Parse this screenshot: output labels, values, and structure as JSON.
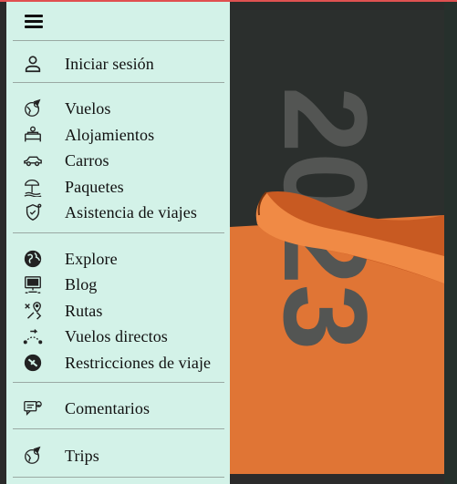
{
  "menu": {
    "account": [
      {
        "id": "login",
        "label": "Iniciar sesión",
        "icon": "user-icon"
      }
    ],
    "travel": [
      {
        "id": "flights",
        "label": "Vuelos",
        "icon": "globe-plane-icon"
      },
      {
        "id": "lodging",
        "label": "Alojamientos",
        "icon": "bed-icon"
      },
      {
        "id": "cars",
        "label": "Carros",
        "icon": "car-icon"
      },
      {
        "id": "packages",
        "label": "Paquetes",
        "icon": "beach-umbrella-icon"
      },
      {
        "id": "insurance",
        "label": "Asistencia de viajes",
        "icon": "shield-sun-icon"
      }
    ],
    "discover": [
      {
        "id": "explore",
        "label": "Explore",
        "icon": "globe-icon"
      },
      {
        "id": "blog",
        "label": "Blog",
        "icon": "monitor-icon"
      },
      {
        "id": "routes",
        "label": "Rutas",
        "icon": "route-pin-icon"
      },
      {
        "id": "direct",
        "label": "Vuelos directos",
        "icon": "direct-flight-icon"
      },
      {
        "id": "restrictions",
        "label": "Restricciones de viaje",
        "icon": "plane-restriction-icon"
      }
    ],
    "feedback": [
      {
        "id": "comments",
        "label": "Comentarios",
        "icon": "feedback-bubble-icon"
      }
    ],
    "trips": [
      {
        "id": "trips",
        "label": "Trips",
        "icon": "globe-plane-icon"
      }
    ]
  },
  "promo": {
    "year_text": "2023",
    "colors": {
      "dark": "#2b2f2d",
      "orange": "#e07535",
      "digits": "#535553"
    }
  }
}
